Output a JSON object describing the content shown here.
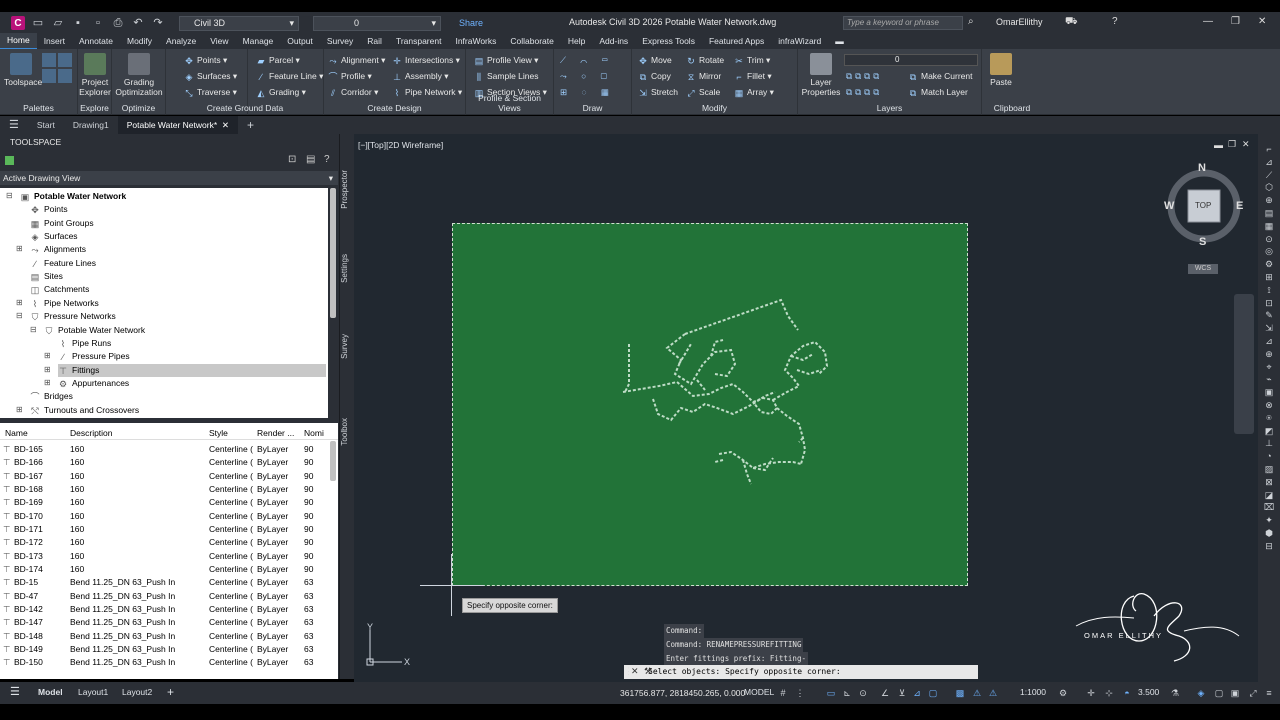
{
  "titlebar": {
    "logo": "C",
    "workspace": "Civil 3D",
    "layer": "0",
    "share": "Share",
    "doc_title": "Autodesk Civil 3D 2026   Potable Water Network.dwg",
    "search_placeholder": "Type a keyword or phrase",
    "user": "OmarEllithy"
  },
  "menu": [
    "Home",
    "Insert",
    "Annotate",
    "Modify",
    "Analyze",
    "View",
    "Manage",
    "Output",
    "Survey",
    "Rail",
    "Transparent",
    "InfraWorks",
    "Collaborate",
    "Help",
    "Add-ins",
    "Express Tools",
    "Featured Apps",
    "infraWizard"
  ],
  "ribbon": {
    "palettes": {
      "toolspace": "Toolspace",
      "title": "Palettes"
    },
    "explore": {
      "label1": "Project",
      "label2": "Explorer",
      "title": "Explore"
    },
    "optimize": {
      "label1": "Grading",
      "label2": "Optimization",
      "title": "Optimize"
    },
    "ground": {
      "points": "Points",
      "surfaces": "Surfaces",
      "traverse": "Traverse",
      "parcel": "Parcel",
      "feature_line": "Feature Line",
      "grading": "Grading",
      "title": "Create Ground Data"
    },
    "design": {
      "alignment": "Alignment",
      "profile": "Profile",
      "corridor": "Corridor",
      "intersections": "Intersections",
      "assembly": "Assembly",
      "pipe_network": "Pipe Network",
      "title": "Create Design"
    },
    "profile_views": {
      "profile_view": "Profile View",
      "sample_lines": "Sample Lines",
      "section_views": "Section Views",
      "title": "Profile & Section Views"
    },
    "draw": {
      "title": "Draw"
    },
    "modify": {
      "move": "Move",
      "copy": "Copy",
      "stretch": "Stretch",
      "rotate": "Rotate",
      "mirror": "Mirror",
      "scale": "Scale",
      "trim": "Trim",
      "fillet": "Fillet",
      "array": "Array",
      "title": "Modify"
    },
    "layers": {
      "layer_props1": "Layer",
      "layer_props2": "Properties",
      "current": "0",
      "make_current": "Make Current",
      "match_layer": "Match Layer",
      "title": "Layers"
    },
    "clipboard": {
      "paste": "Paste",
      "title": "Clipboard"
    }
  },
  "doc_tabs": [
    "Start",
    "Drawing1",
    "Potable Water Network*"
  ],
  "toolspace": {
    "header": "TOOLSPACE",
    "view": "Active Drawing View",
    "vtabs": [
      "Prospector",
      "Settings",
      "Survey",
      "Toolbox"
    ],
    "tree": [
      {
        "label": "Potable Water Network",
        "level": 0,
        "bold": true,
        "exp": "⊟",
        "icon": "▣"
      },
      {
        "label": "Points",
        "level": 1,
        "exp": "",
        "icon": "✥"
      },
      {
        "label": "Point Groups",
        "level": 1,
        "exp": "",
        "icon": "▦"
      },
      {
        "label": "Surfaces",
        "level": 1,
        "exp": "",
        "icon": "◈"
      },
      {
        "label": "Alignments",
        "level": 1,
        "exp": "⊞",
        "icon": "⤳"
      },
      {
        "label": "Feature Lines",
        "level": 1,
        "exp": "",
        "icon": "∕"
      },
      {
        "label": "Sites",
        "level": 1,
        "exp": "",
        "icon": "▤"
      },
      {
        "label": "Catchments",
        "level": 1,
        "exp": "",
        "icon": "◫"
      },
      {
        "label": "Pipe Networks",
        "level": 1,
        "exp": "⊞",
        "icon": "⌇"
      },
      {
        "label": "Pressure Networks",
        "level": 1,
        "exp": "⊟",
        "icon": "⛉"
      },
      {
        "label": "Potable Water Network",
        "level": 2,
        "exp": "⊟",
        "icon": "⛉"
      },
      {
        "label": "Pipe Runs",
        "level": 3,
        "exp": "",
        "icon": "⌇"
      },
      {
        "label": "Pressure Pipes",
        "level": 3,
        "exp": "⊞",
        "icon": "∕"
      },
      {
        "label": "Fittings",
        "level": 3,
        "exp": "⊞",
        "icon": "⊤",
        "selected": true
      },
      {
        "label": "Appurtenances",
        "level": 3,
        "exp": "⊞",
        "icon": "⚙"
      },
      {
        "label": "Bridges",
        "level": 1,
        "exp": "",
        "icon": "⌒"
      },
      {
        "label": "Turnouts and Crossovers",
        "level": 1,
        "exp": "⊞",
        "icon": "⤲"
      }
    ],
    "columns": [
      "Name",
      "Description",
      "Style",
      "Render ...",
      "Nomi"
    ],
    "rows": [
      [
        "BD-165",
        "160",
        "Centerline (",
        "ByLayer",
        "90"
      ],
      [
        "BD-166",
        "160",
        "Centerline (",
        "ByLayer",
        "90"
      ],
      [
        "BD-167",
        "160",
        "Centerline (",
        "ByLayer",
        "90"
      ],
      [
        "BD-168",
        "160",
        "Centerline (",
        "ByLayer",
        "90"
      ],
      [
        "BD-169",
        "160",
        "Centerline (",
        "ByLayer",
        "90"
      ],
      [
        "BD-170",
        "160",
        "Centerline (",
        "ByLayer",
        "90"
      ],
      [
        "BD-171",
        "160",
        "Centerline (",
        "ByLayer",
        "90"
      ],
      [
        "BD-172",
        "160",
        "Centerline (",
        "ByLayer",
        "90"
      ],
      [
        "BD-173",
        "160",
        "Centerline (",
        "ByLayer",
        "90"
      ],
      [
        "BD-174",
        "160",
        "Centerline (",
        "ByLayer",
        "90"
      ],
      [
        "BD-15",
        "Bend 11.25_DN 63_Push In",
        "Centerline (",
        "ByLayer",
        "63"
      ],
      [
        "BD-47",
        "Bend 11.25_DN 63_Push In",
        "Centerline (",
        "ByLayer",
        "63"
      ],
      [
        "BD-142",
        "Bend 11.25_DN 63_Push In",
        "Centerline (",
        "ByLayer",
        "63"
      ],
      [
        "BD-147",
        "Bend 11.25_DN 63_Push In",
        "Centerline (",
        "ByLayer",
        "63"
      ],
      [
        "BD-148",
        "Bend 11.25_DN 63_Push In",
        "Centerline (",
        "ByLayer",
        "63"
      ],
      [
        "BD-149",
        "Bend 11.25_DN 63_Push In",
        "Centerline (",
        "ByLayer",
        "63"
      ],
      [
        "BD-150",
        "Bend 11.25_DN 63_Push In",
        "Centerline (",
        "ByLayer",
        "63"
      ]
    ]
  },
  "drawing": {
    "view_label": "[−][Top][2D Wireframe]",
    "tooltip": "Specify opposite corner:",
    "viewcube": {
      "n": "N",
      "s": "S",
      "e": "E",
      "w": "W",
      "top": "TOP",
      "wcs": "WCS"
    },
    "command_history": [
      "Command:",
      "Command: RENAMEPRESSUREFITTING",
      "Enter fittings prefix: Fitting-"
    ],
    "command_line": "Select objects: Specify opposite corner:",
    "watermark_name": "OMAR ELLITHY",
    "selection_color": "#227338"
  },
  "status": {
    "tabs": [
      "Model",
      "Layout1",
      "Layout2"
    ],
    "coords": "361756.877, 2818450.265, 0.000",
    "model": "MODEL",
    "scale": "1:1000",
    "value": "3.500"
  }
}
